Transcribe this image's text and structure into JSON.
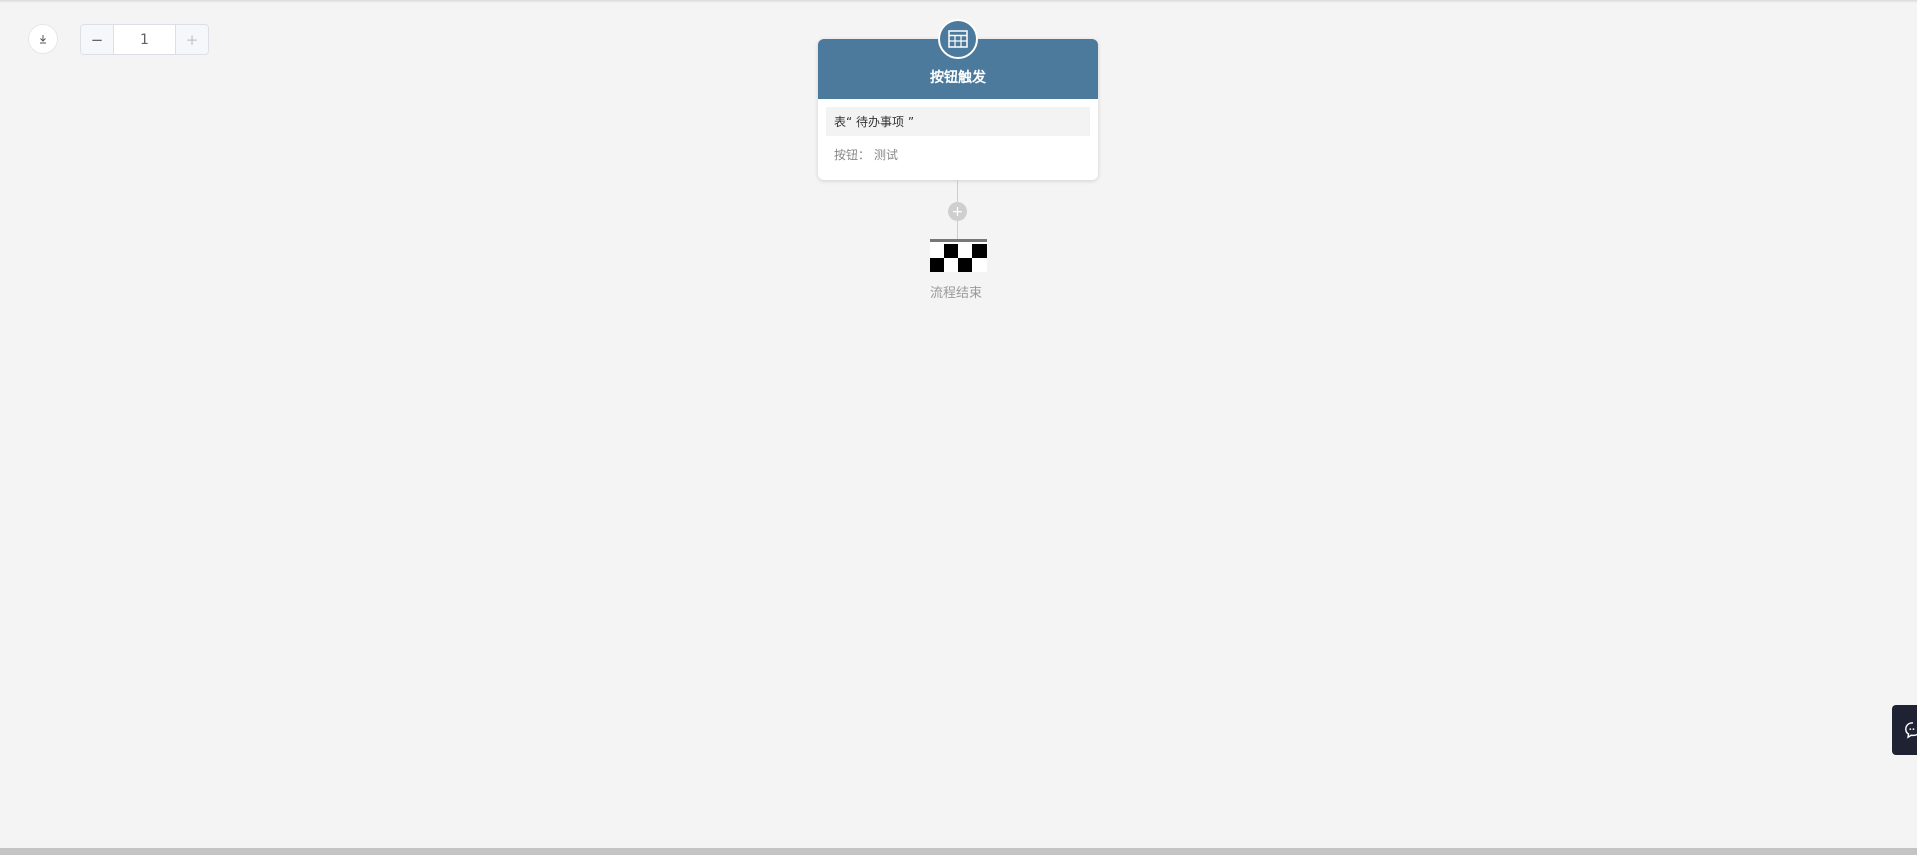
{
  "toolbar": {
    "download_icon": "download-icon",
    "zoom_minus": "−",
    "zoom_value": "1",
    "zoom_plus": "+"
  },
  "node": {
    "title": "按钮触发",
    "icon": "table-icon",
    "table_label": "表“ 待办事项 ”",
    "button_label": "按钮：",
    "button_value": "测试"
  },
  "connector": {
    "add_symbol": "+"
  },
  "end": {
    "label": "流程结束",
    "icon": "checkered-flag-icon"
  },
  "chat": {
    "icon": "chat-bubble-icon"
  },
  "colors": {
    "background": "#f4f4f4",
    "node_header": "#4c7a9c",
    "chat_widget": "#1f2233"
  }
}
